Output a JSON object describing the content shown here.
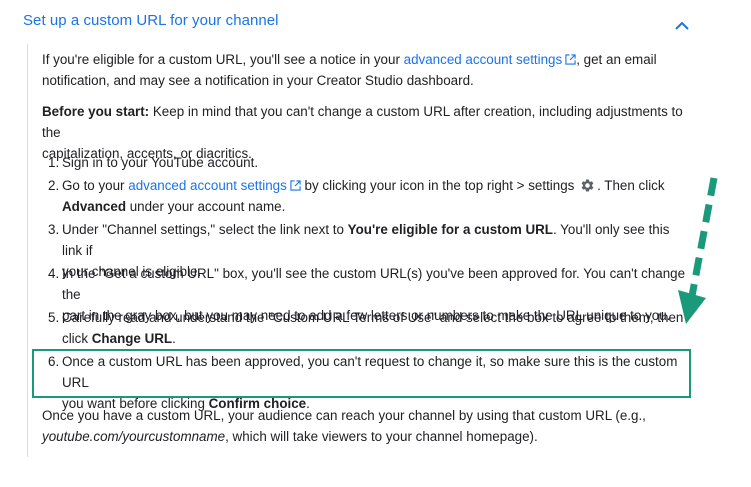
{
  "section": {
    "title": "Set up a custom URL for your channel",
    "intro": {
      "before_link": "If you're eligible for a custom URL, you'll see a notice in your ",
      "link": "advanced account settings",
      "after_link_line1": ", get an email",
      "line2": "notification, and may see a notification in your Creator Studio dashboard."
    },
    "before_start": {
      "label": "Before you start:",
      "text_line1": " Keep in mind that you can't change a custom URL after creation, including adjustments to the",
      "text_line2": "capitalization, accents, or diacritics."
    },
    "steps": [
      {
        "num": "1.",
        "text": "Sign in to your YouTube account."
      },
      {
        "num": "2.",
        "before_link": "Go to your ",
        "link": "advanced account settings",
        "after_link": " by clicking your icon in the top right > settings ",
        "after_icon": ". Then click",
        "bold": "Advanced",
        "end": " under your account name."
      },
      {
        "num": "3.",
        "before": "Under \"Channel settings,\" select the link next to ",
        "bold": "You're eligible for a custom URL",
        "after_line1": ". You'll only see this link if",
        "line2": "your channel is eligible."
      },
      {
        "num": "4.",
        "line1": "In the \"Get a custom URL\" box, you'll see the custom URL(s) you've been approved for. You can't change the",
        "line2": "part in the gray box, but you may need to add a few letters or numbers to make the URL unique to you."
      },
      {
        "num": "5.",
        "line1": "Carefully read and understand the \"Custom URL Terms of Use\" and select the box to agree to them, then",
        "before_bold": "click ",
        "bold": "Change URL",
        "end": "."
      },
      {
        "num": "6.",
        "line1": "Once a custom URL has been approved, you can't request to change it, so make sure this is the custom URL",
        "before_bold": "you want before clicking ",
        "bold": "Confirm choice",
        "end": "."
      }
    ],
    "outro": {
      "line1": "Once you have a custom URL, your audience can reach your channel by using that custom URL (e.g.,",
      "italic": "youtube.com/yourcustomname",
      "line2_after": ", which will take viewers to your channel homepage)."
    }
  },
  "icons": {
    "collapse": "chevron-up-icon",
    "external": "external-link-icon",
    "settings": "gear-icon",
    "annotation": "dashed-arrow-icon"
  },
  "colors": {
    "link": "#1a73e8",
    "text": "#202124",
    "highlight": "#1a9a7a"
  }
}
